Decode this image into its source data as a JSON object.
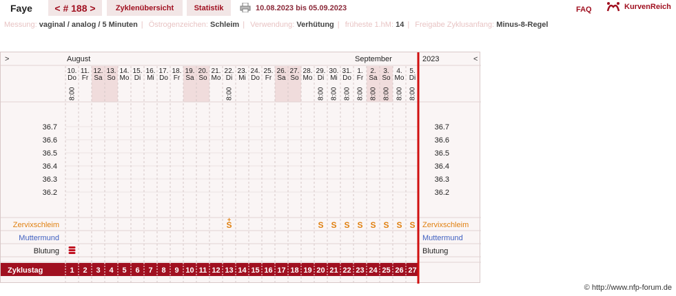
{
  "header": {
    "name": "Faye",
    "prev": "<",
    "cycle_label": "# 188",
    "next": ">",
    "tab_overview": "Zyklenübersicht",
    "tab_stats": "Statistik",
    "date_range": "10.08.2023 bis 05.09.2023",
    "faq": "FAQ",
    "brand": "KurvenReich",
    "icons": [
      "printer-icon",
      "kurvenreich-logo-icon"
    ]
  },
  "info": [
    {
      "key": "Messung:",
      "value": "vaginal / analog / 5 Minuten"
    },
    {
      "key": "Östrogenzeichen:",
      "value": "Schleim"
    },
    {
      "key": "Verwendung:",
      "value": "Verhütung"
    },
    {
      "key": "früheste 1.hM:",
      "value": "14"
    },
    {
      "key": "Freigabe Zyklusanfang:",
      "value": "Minus-8-Regel"
    }
  ],
  "chart": {
    "nav_left": ">",
    "nav_right": "<",
    "month1": "August",
    "month2": "September",
    "year": "2023",
    "temp_ticks": [
      "36.7",
      "36.6",
      "36.5",
      "36.4",
      "36.3",
      "36.2"
    ],
    "row_labels": {
      "cervical": "Zervixschleim",
      "cervix": "Muttermund",
      "bleeding": "Blutung",
      "cycleday": "Zyklustag"
    },
    "time_value": "8:00",
    "mucus_symbol": "S",
    "mucus_plus": "+",
    "days": [
      {
        "date": "10.",
        "dow": "Do",
        "time": "8:00",
        "cd": "1",
        "bleed": true
      },
      {
        "date": "11.",
        "dow": "Fr",
        "cd": "2"
      },
      {
        "date": "12.",
        "dow": "Sa",
        "cd": "3",
        "weekend": true
      },
      {
        "date": "13.",
        "dow": "So",
        "cd": "4",
        "weekend": true
      },
      {
        "date": "14.",
        "dow": "Mo",
        "cd": "5"
      },
      {
        "date": "15.",
        "dow": "Di",
        "cd": "6"
      },
      {
        "date": "16.",
        "dow": "Mi",
        "cd": "7"
      },
      {
        "date": "17.",
        "dow": "Do",
        "cd": "8"
      },
      {
        "date": "18.",
        "dow": "Fr",
        "cd": "9"
      },
      {
        "date": "19.",
        "dow": "Sa",
        "cd": "10",
        "weekend": true
      },
      {
        "date": "20.",
        "dow": "So",
        "cd": "11",
        "weekend": true
      },
      {
        "date": "21.",
        "dow": "Mo",
        "cd": "12"
      },
      {
        "date": "22.",
        "dow": "Di",
        "time": "8:00",
        "cd": "13",
        "mucus": "S+"
      },
      {
        "date": "23.",
        "dow": "Mi",
        "cd": "14"
      },
      {
        "date": "24.",
        "dow": "Do",
        "cd": "15"
      },
      {
        "date": "25.",
        "dow": "Fr",
        "cd": "16"
      },
      {
        "date": "26.",
        "dow": "Sa",
        "cd": "17",
        "weekend": true
      },
      {
        "date": "27.",
        "dow": "So",
        "cd": "18",
        "weekend": true
      },
      {
        "date": "28.",
        "dow": "Mo",
        "cd": "19"
      },
      {
        "date": "29.",
        "dow": "Di",
        "time": "8:00",
        "cd": "20",
        "mucus": "S"
      },
      {
        "date": "30.",
        "dow": "Mi",
        "time": "8:00",
        "cd": "21",
        "mucus": "S"
      },
      {
        "date": "31.",
        "dow": "Do",
        "time": "8:00",
        "cd": "22",
        "mucus": "S"
      },
      {
        "date": "1.",
        "dow": "Fr",
        "time": "8:00",
        "cd": "23",
        "mucus": "S"
      },
      {
        "date": "2.",
        "dow": "Sa",
        "time": "8:00",
        "cd": "24",
        "mucus": "S",
        "weekend": true
      },
      {
        "date": "3.",
        "dow": "So",
        "time": "8:00",
        "cd": "25",
        "mucus": "S",
        "weekend": true
      },
      {
        "date": "4.",
        "dow": "Mo",
        "time": "8:00",
        "cd": "26",
        "mucus": "S"
      },
      {
        "date": "5.",
        "dow": "Di",
        "time": "8:00",
        "cd": "27",
        "mucus": "S"
      }
    ]
  },
  "colors": {
    "accent": "#a01020",
    "mucus": "#e08010",
    "cervix": "#4060c0",
    "weekend": "#f0dcdc",
    "cycle_bar": "#a01020"
  },
  "copyright": "© http://www.nfp-forum.de"
}
